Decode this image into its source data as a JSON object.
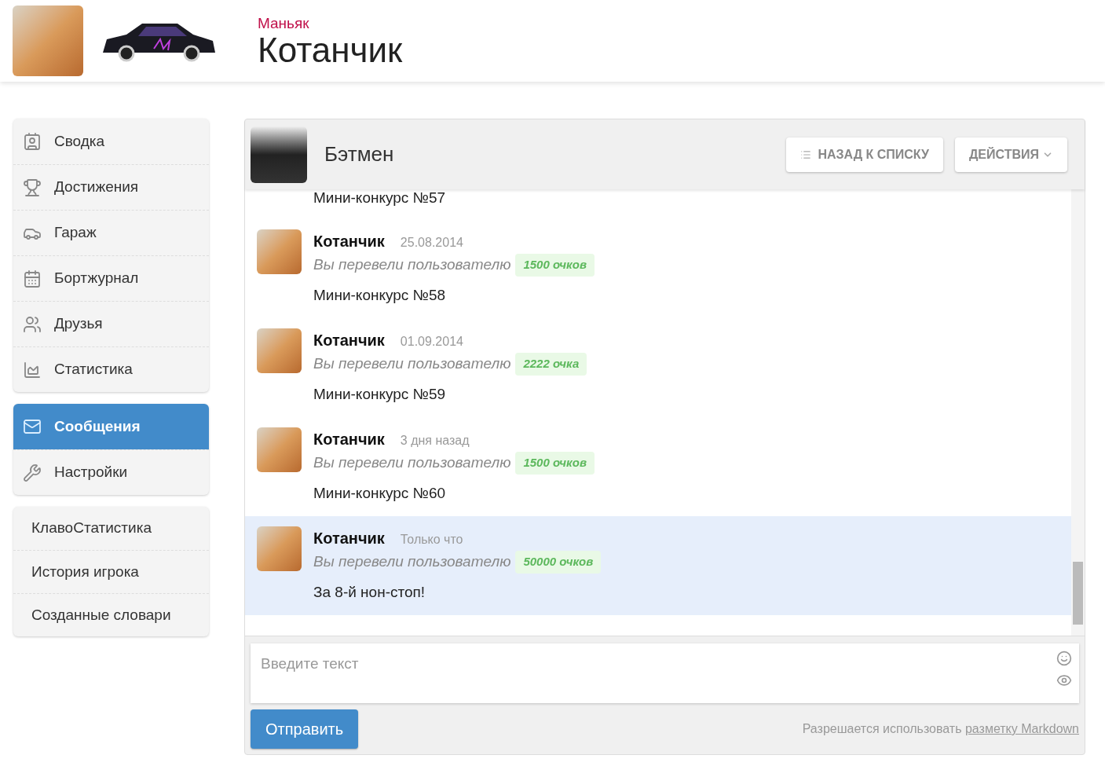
{
  "header": {
    "rank": "Маньяк",
    "username": "Котанчик"
  },
  "sidebar": {
    "groups": [
      {
        "items": [
          {
            "label": "Сводка",
            "selected": false
          },
          {
            "label": "Достижения",
            "selected": false
          },
          {
            "label": "Гараж",
            "selected": false
          },
          {
            "label": "Бортжурнал",
            "selected": false
          },
          {
            "label": "Друзья",
            "selected": false
          },
          {
            "label": "Статистика",
            "selected": false
          }
        ]
      },
      {
        "items": [
          {
            "label": "Сообщения",
            "selected": true
          },
          {
            "label": "Настройки",
            "selected": false
          }
        ]
      },
      {
        "items": [
          {
            "label": "КлавоСтатистика",
            "selected": false
          },
          {
            "label": "История игрока",
            "selected": false
          },
          {
            "label": "Созданные словари",
            "selected": false
          }
        ]
      }
    ]
  },
  "conversation": {
    "title": "Бэтмен",
    "back_button": "НАЗАД К СПИСКУ",
    "actions_button": "ДЕЙСТВИЯ",
    "partial_text": "Мини-конкурс №57",
    "messages": [
      {
        "author": "Котанчик",
        "time": "25.08.2014",
        "note": "Вы перевели пользователю",
        "amount": "1500 очков",
        "text": "Мини-конкурс №58",
        "highlighted": false
      },
      {
        "author": "Котанчик",
        "time": "01.09.2014",
        "note": "Вы перевели пользователю",
        "amount": "2222 очка",
        "text": "Мини-конкурс №59",
        "highlighted": false
      },
      {
        "author": "Котанчик",
        "time": "3 дня назад",
        "note": "Вы перевели пользователю",
        "amount": "1500 очков",
        "text": "Мини-конкурс №60",
        "highlighted": false
      },
      {
        "author": "Котанчик",
        "time": "Только что",
        "note": "Вы перевели пользователю",
        "amount": "50000 очков",
        "text": "За 8-й нон-стоп!",
        "highlighted": true
      }
    ],
    "composer": {
      "placeholder": "Введите текст",
      "send_button": "Отправить",
      "hint": "Разрешается использовать",
      "hint_link": "разметку Markdown"
    }
  }
}
